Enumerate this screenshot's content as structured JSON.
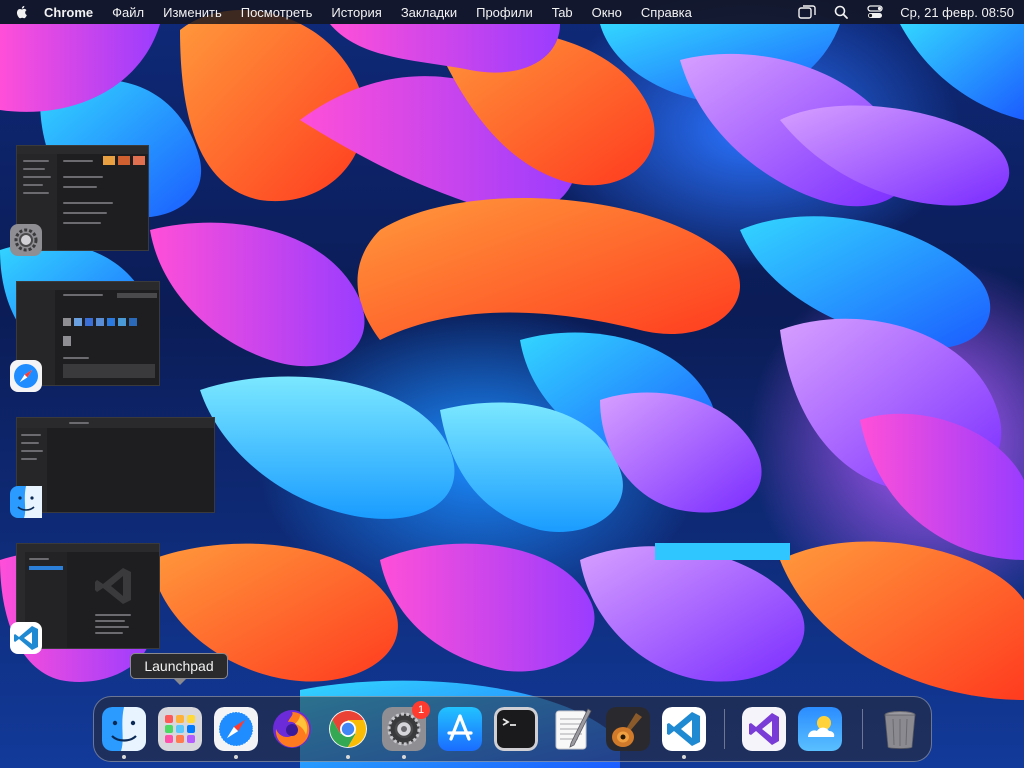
{
  "menubar": {
    "app_name": "Chrome",
    "items": [
      "Файл",
      "Изменить",
      "Посмотреть",
      "История",
      "Закладки",
      "Профили",
      "Tab",
      "Окно",
      "Справка"
    ],
    "clock": "Ср, 21 февр.  08:50",
    "status_icons": [
      "window-switcher-icon",
      "search-icon",
      "control-center-icon"
    ]
  },
  "window_thumbnails": [
    {
      "app_icon": "system-settings-icon",
      "app": "System Settings"
    },
    {
      "app_icon": "safari-icon",
      "app": "Safari"
    },
    {
      "app_icon": "finder-icon",
      "app": "Finder"
    },
    {
      "app_icon": "vscode-icon",
      "app": "Visual Studio Code"
    }
  ],
  "tooltip": {
    "text": "Launchpad"
  },
  "dock": {
    "items": [
      {
        "name": "finder",
        "running": true
      },
      {
        "name": "launchpad",
        "running": false
      },
      {
        "name": "safari",
        "running": true
      },
      {
        "name": "firefox",
        "running": false
      },
      {
        "name": "chrome",
        "running": true
      },
      {
        "name": "system-settings",
        "running": true,
        "badge": "1"
      },
      {
        "name": "app-store",
        "running": false
      },
      {
        "name": "terminal",
        "running": false
      },
      {
        "name": "textedit",
        "running": false
      },
      {
        "name": "garageband",
        "running": false
      },
      {
        "name": "vscode",
        "running": true
      },
      {
        "name": "visual-studio",
        "running": false
      },
      {
        "name": "weather",
        "running": false
      },
      {
        "name": "trash",
        "running": false
      }
    ]
  },
  "colors": {
    "menubar_bg": "#14141c",
    "badge": "#ff3b30",
    "wallpaper_orange": "#ff5a1f",
    "wallpaper_magenta": "#e03ccf",
    "wallpaper_blue": "#1b8cff",
    "wallpaper_purple": "#8a3cff"
  }
}
